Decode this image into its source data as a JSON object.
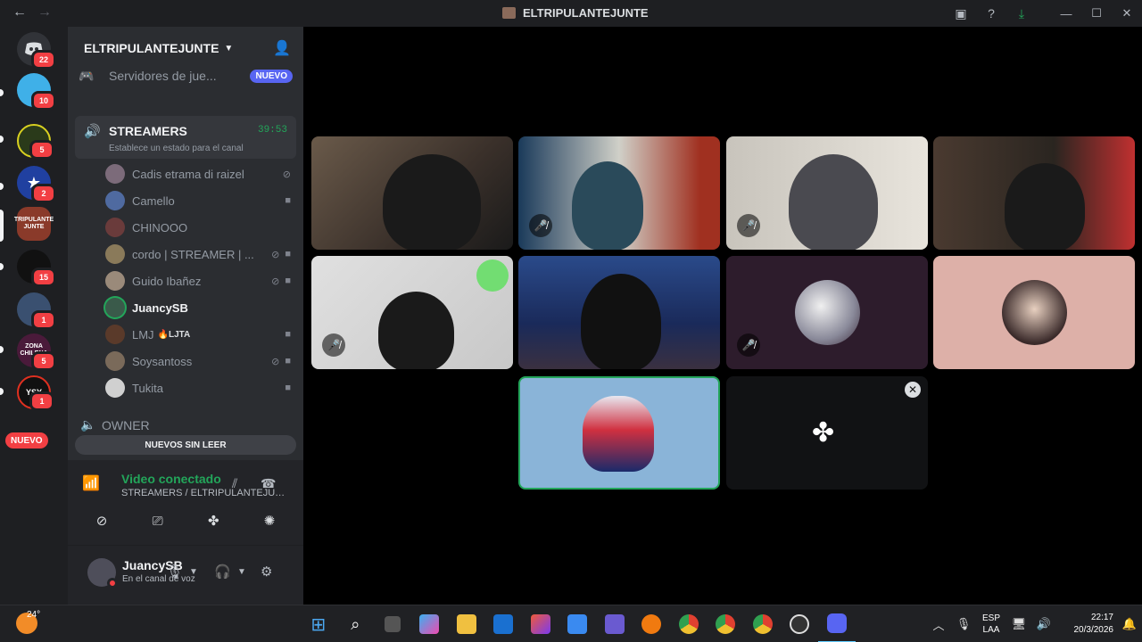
{
  "window": {
    "title": "ELTRIPULANTEJUNTE",
    "back_icon": "←",
    "forward_icon": "→"
  },
  "server_rail": {
    "badges": [
      "22",
      "10",
      "5",
      "2",
      "15",
      "1",
      "5",
      "1"
    ],
    "nuevo_label": "NUEVO",
    "labels": {
      "tripulante": "TRIPULANTE JUNTE",
      "zona": "ZONA CHILENA",
      "game": "YSY"
    }
  },
  "sidebar": {
    "server_name": "ELTRIPULANTEJUNTE",
    "browse_label": "Servidores de jue...",
    "browse_tag": "NUEVO",
    "voice_channel": {
      "name": "STREAMERS",
      "timer": "39:53",
      "status_placeholder": "Establece un estado para el canal"
    },
    "members": [
      {
        "name": "Cadis etrama di raizel",
        "color": "#7c6b7a"
      },
      {
        "name": "Camello",
        "color": "#4f6aa0"
      },
      {
        "name": "CHINOOO",
        "color": "#6a3b3b"
      },
      {
        "name": "cordo | STREAMER | ...",
        "color": "#8a7a5a"
      },
      {
        "name": "Guido Ibañez",
        "color": "#9a8a7a"
      },
      {
        "name": "JuancySB",
        "color": "#3a5a4a"
      },
      {
        "name": "LMJ",
        "color": "#5a3a2a",
        "tag": "🔥LJTA"
      },
      {
        "name": "Soysantoss",
        "color": "#7a6a5a"
      },
      {
        "name": "Tukita",
        "color": "#d0d0d0"
      }
    ],
    "owner_category": "OWNER",
    "unread_bar": "NUEVOS SIN LEER"
  },
  "voice_panel": {
    "status": "Video conectado",
    "path": "STREAMERS / ELTRIPULANTEJUNTE..."
  },
  "user_panel": {
    "username": "JuancySB",
    "substatus": "En el canal de voz"
  },
  "taskbar": {
    "temperature": "24°",
    "lang_line1": "ESP",
    "lang_line2": "LAA",
    "time": "22:17",
    "date": "20/3/2026"
  },
  "colors": {
    "accent_green": "#23a55a",
    "badge_red": "#f23f43",
    "blurple": "#5865f2"
  }
}
